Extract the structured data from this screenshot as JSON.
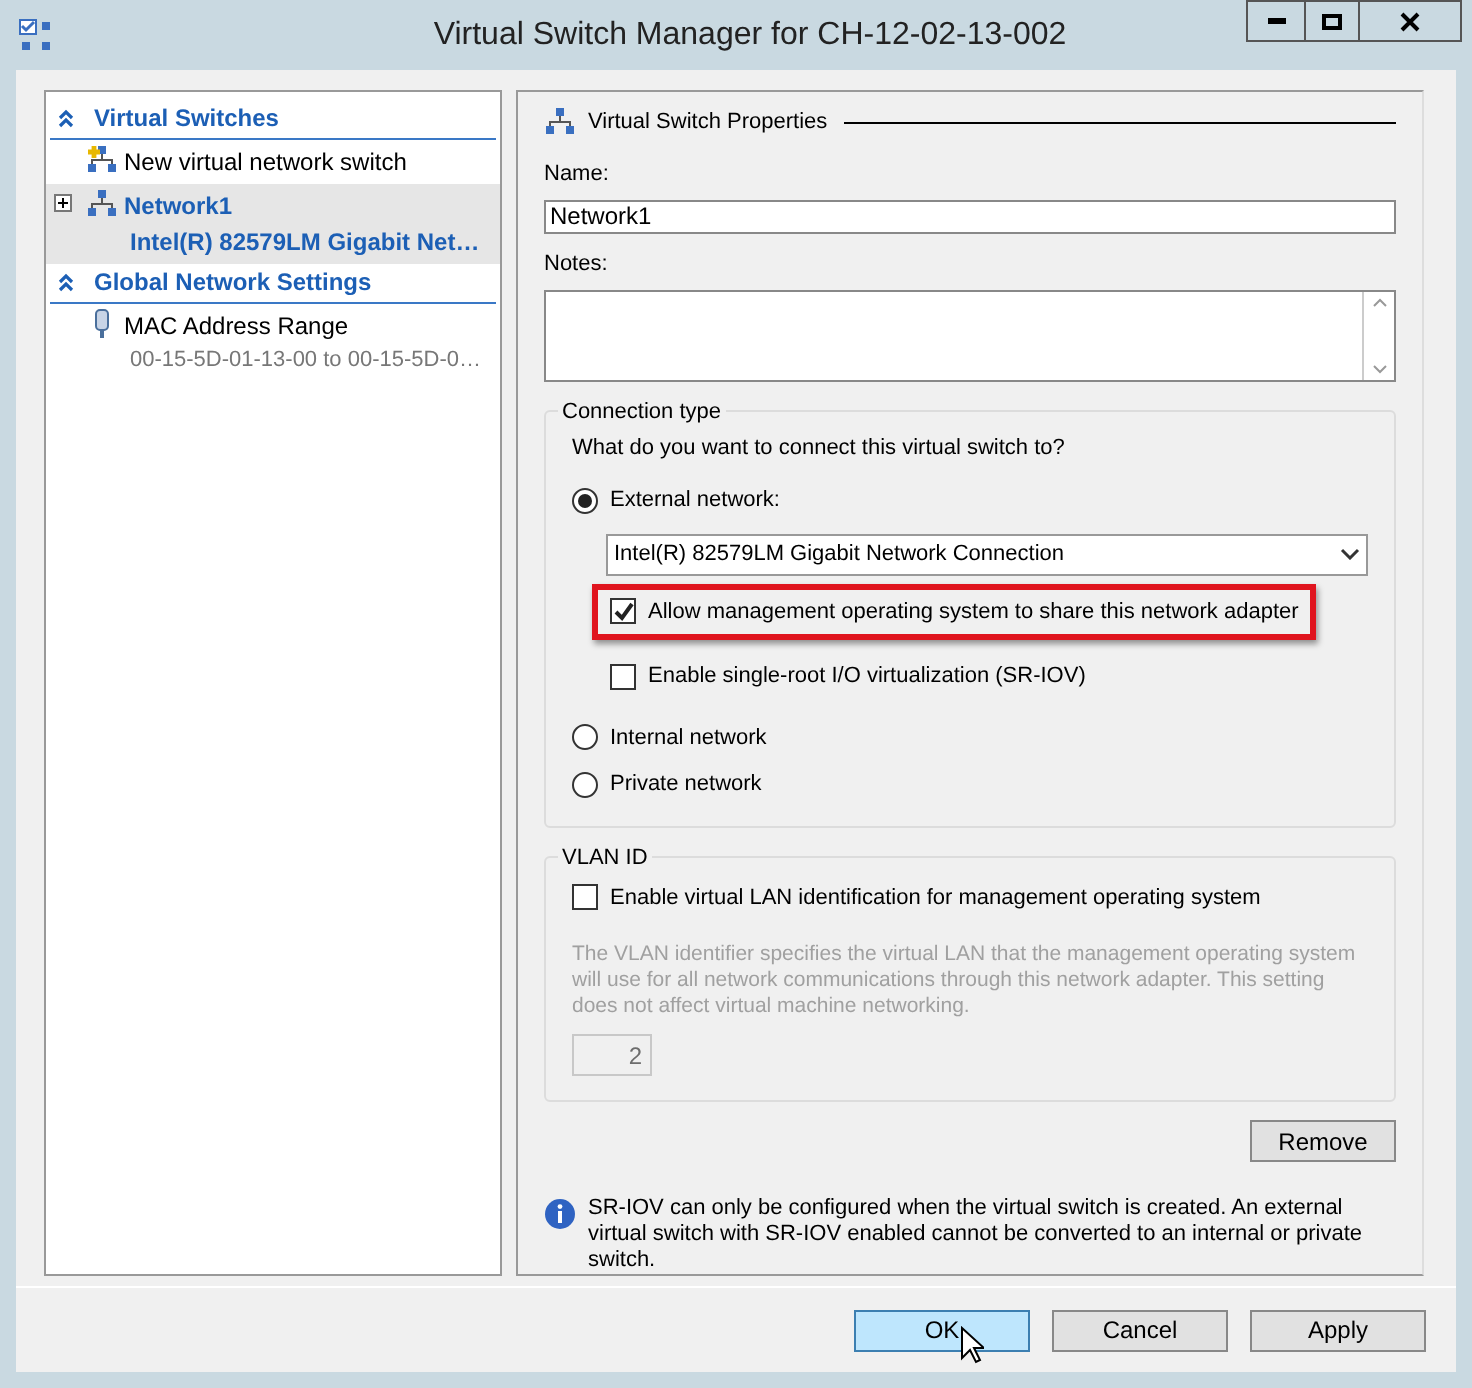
{
  "window": {
    "title": "Virtual Switch Manager for CH-12-02-13-002"
  },
  "sidebar": {
    "sections": [
      {
        "title": "Virtual Switches",
        "items": [
          {
            "kind": "action",
            "label": "New virtual network switch",
            "selected": false
          },
          {
            "kind": "switch",
            "label": "Network1",
            "detail": "Intel(R) 82579LM Gigabit Net…",
            "selected": true,
            "expanded": false
          }
        ]
      },
      {
        "title": "Global Network Settings",
        "items": [
          {
            "kind": "setting",
            "label": "MAC Address Range",
            "detail": "00-15-5D-01-13-00 to 00-15-5D-0…",
            "selected": false
          }
        ]
      }
    ]
  },
  "properties": {
    "title": "Virtual Switch Properties",
    "name_label": "Name:",
    "name_value": "Network1",
    "notes_label": "Notes:",
    "connection": {
      "title": "Connection type",
      "question": "What do you want to connect this virtual switch to?",
      "options": [
        {
          "label": "External network:",
          "selected": true
        },
        {
          "label": "Internal network",
          "selected": false
        },
        {
          "label": "Private network",
          "selected": false
        }
      ],
      "adapter": "Intel(R) 82579LM Gigabit Network Connection",
      "checkboxes": [
        {
          "label": "Allow management operating system to share this network adapter",
          "checked": true,
          "highlighted": true
        },
        {
          "label": "Enable single-root I/O virtualization (SR-IOV)",
          "checked": false,
          "highlighted": false
        }
      ]
    },
    "vlan": {
      "title": "VLAN ID",
      "checkbox": {
        "label": "Enable virtual LAN identification for management operating system",
        "checked": false
      },
      "description": "The VLAN identifier specifies the virtual LAN that the management operating system will use for all network communications through this network adapter. This setting does not affect virtual machine networking.",
      "value": "2",
      "disabled": true
    },
    "remove_button": "Remove",
    "info": "SR-IOV can only be configured when the virtual switch is created. An external virtual switch with SR-IOV enabled cannot be converted to an internal or private switch."
  },
  "buttons": [
    {
      "label": "OK",
      "default": true
    },
    {
      "label": "Cancel",
      "default": false
    },
    {
      "label": "Apply",
      "default": false
    }
  ]
}
